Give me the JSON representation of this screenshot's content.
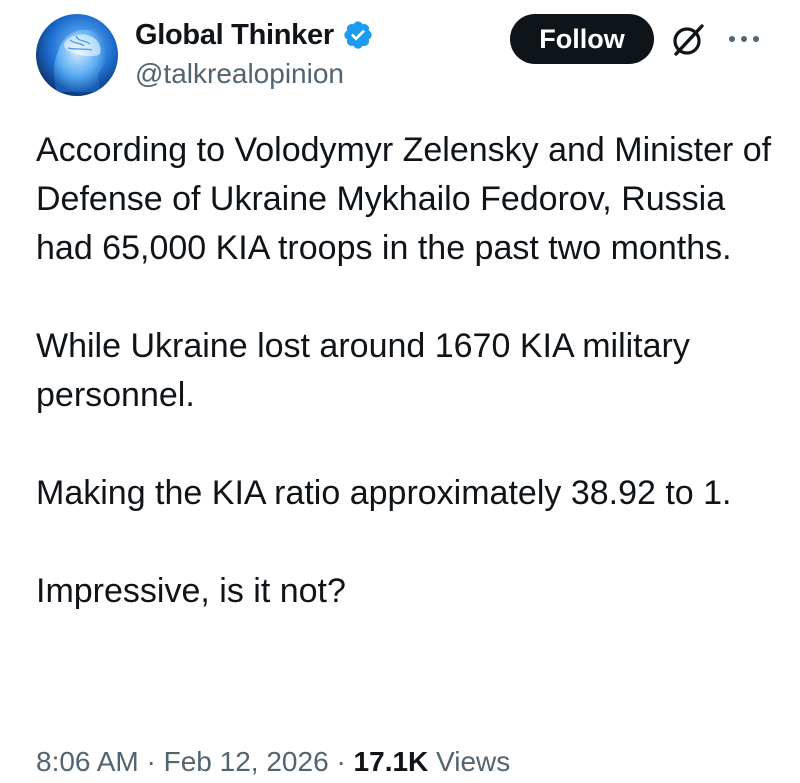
{
  "author": {
    "display_name": "Global Thinker",
    "handle": "@talkrealopinion",
    "avatar_icon": "brain-head-avatar",
    "verified_icon": "verified-badge-icon",
    "verified_color": "#1d9bf0"
  },
  "actions": {
    "follow_label": "Follow",
    "grok_icon": "grok-icon",
    "more_icon": "more-options-icon"
  },
  "tweet": {
    "paragraphs": [
      "According to Volodymyr Zelensky and Minister of Defense of Ukraine Mykhailo Fedorov, Russia had 65,000 KIA troops in the past two months.",
      "While Ukraine lost around 1670 KIA military personnel.",
      "Making the KIA ratio approximately 38.92 to 1.",
      "Impressive, is it not?"
    ]
  },
  "meta": {
    "time": "8:06 AM",
    "separator": "·",
    "date": "Feb 12, 2026",
    "views_count": "17.1K",
    "views_label": "Views"
  },
  "colors": {
    "text_primary": "#0f1419",
    "text_secondary": "#536471",
    "button_bg": "#0f1419",
    "button_text": "#ffffff"
  }
}
